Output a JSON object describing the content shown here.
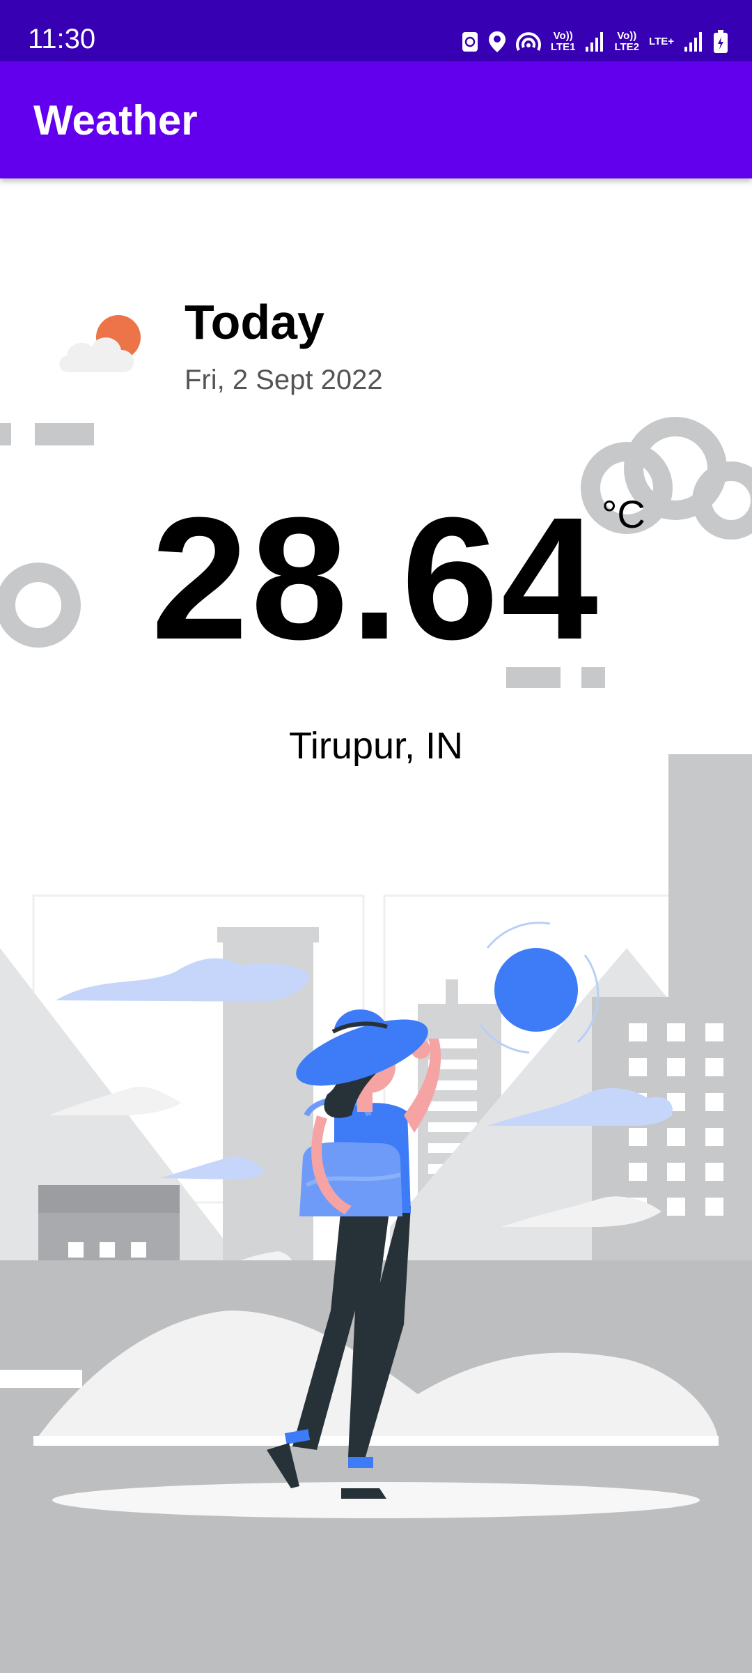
{
  "status_bar": {
    "time": "11:30",
    "icons": [
      "recycle-icon",
      "location-icon",
      "hotspot-icon",
      "volte-lte1-icon",
      "signal-icon",
      "volte-lte2-icon",
      "lte-plus-icon",
      "signal-icon",
      "battery-icon"
    ],
    "lte1_label": "Vo))\nLTE1",
    "lte2_label": "Vo))\nLTE2",
    "lteplus_label": "LTE+"
  },
  "app_bar": {
    "title": "Weather"
  },
  "weather": {
    "condition_icon": "partly-cloudy-icon",
    "day_label": "Today",
    "date": "Fri, 2 Sept 2022",
    "temperature": "28.64",
    "unit": "°C",
    "location": "Tirupur, IN"
  },
  "colors": {
    "status_bar": "#3700B3",
    "app_bar": "#6200EE",
    "illustration_gray": "#C7C8CA",
    "illustration_blue": "#3D7BF7",
    "sun_orange": "#EC7448"
  }
}
